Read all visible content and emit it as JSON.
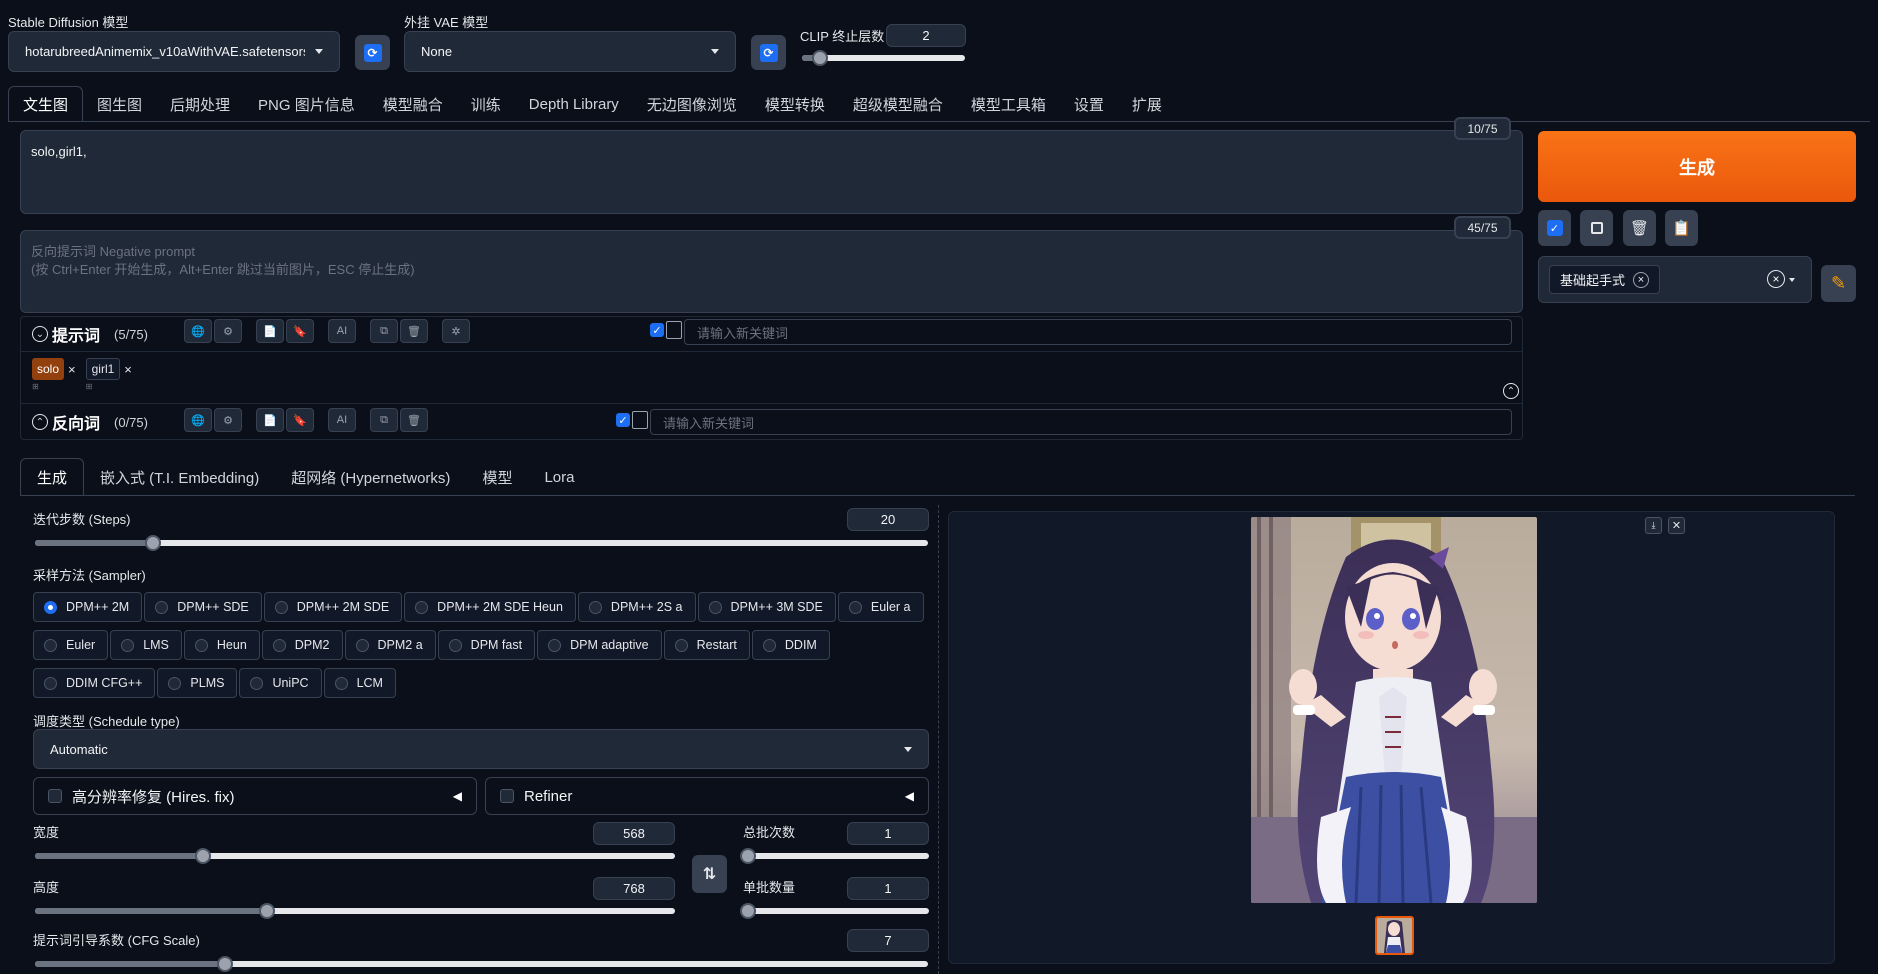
{
  "models": {
    "sd_label": "Stable Diffusion 模型",
    "sd_value": "hotarubreedAnimemix_v10aWithVAE.safetensors",
    "vae_label": "外挂 VAE 模型",
    "vae_value": "None",
    "clip_label": "CLIP 终止层数",
    "clip_value": "2"
  },
  "main_tabs": [
    "文生图",
    "图生图",
    "后期处理",
    "PNG 图片信息",
    "模型融合",
    "训练",
    "Depth Library",
    "无边图像浏览",
    "模型转换",
    "超级模型融合",
    "模型工具箱",
    "设置",
    "扩展"
  ],
  "prompt": {
    "value": "solo,girl1,",
    "counter": "10/75",
    "neg_placeholder_line1": "反向提示词 Negative prompt",
    "neg_placeholder_line2": "(按 Ctrl+Enter 开始生成，Alt+Enter 跳过当前图片，ESC 停止生成)",
    "neg_counter": "45/75"
  },
  "generate": {
    "label": "生成",
    "style_tag": "基础起手式",
    "style_tag_close": "×",
    "style_clear": "×"
  },
  "keywords": {
    "prompt_title": "提示词",
    "prompt_count": "(5/75)",
    "neg_title": "反向词",
    "neg_count": "(0/75)",
    "input_placeholder": "请输入新关键词",
    "tags": [
      {
        "text": "solo",
        "x": "×"
      },
      {
        "text": "girl1",
        "x": "×"
      }
    ]
  },
  "sub_tabs": [
    "生成",
    "嵌入式 (T.I. Embedding)",
    "超网络 (Hypernetworks)",
    "模型",
    "Lora"
  ],
  "steps": {
    "label": "迭代步数 (Steps)",
    "value": "20",
    "fraction": 0.13
  },
  "sampler": {
    "label": "采样方法 (Sampler)",
    "row1": [
      "DPM++ 2M",
      "DPM++ SDE",
      "DPM++ 2M SDE",
      "DPM++ 2M SDE Heun",
      "DPM++ 2S a",
      "DPM++ 3M SDE",
      "Euler a"
    ],
    "row2": [
      "Euler",
      "LMS",
      "Heun",
      "DPM2",
      "DPM2 a",
      "DPM fast",
      "DPM adaptive",
      "Restart",
      "DDIM"
    ],
    "row3": [
      "DDIM CFG++",
      "PLMS",
      "UniPC",
      "LCM"
    ],
    "selected": "DPM++ 2M"
  },
  "schedule": {
    "label": "调度类型 (Schedule type)",
    "value": "Automatic"
  },
  "hires": {
    "label": "高分辨率修复 (Hires. fix)"
  },
  "refiner": {
    "label": "Refiner"
  },
  "width": {
    "label": "宽度",
    "value": "568",
    "fraction": 0.26
  },
  "height": {
    "label": "高度",
    "value": "768",
    "fraction": 0.36
  },
  "batch_count": {
    "label": "总批次数",
    "value": "1",
    "fraction": 0.0
  },
  "batch_size": {
    "label": "单批数量",
    "value": "1",
    "fraction": 0.0
  },
  "cfg": {
    "label": "提示词引导系数 (CFG Scale)",
    "value": "7",
    "fraction": 0.21
  },
  "colors": {
    "accent": "#ea580c",
    "bg": "#0b0f19",
    "check": "#1d6ef2"
  }
}
